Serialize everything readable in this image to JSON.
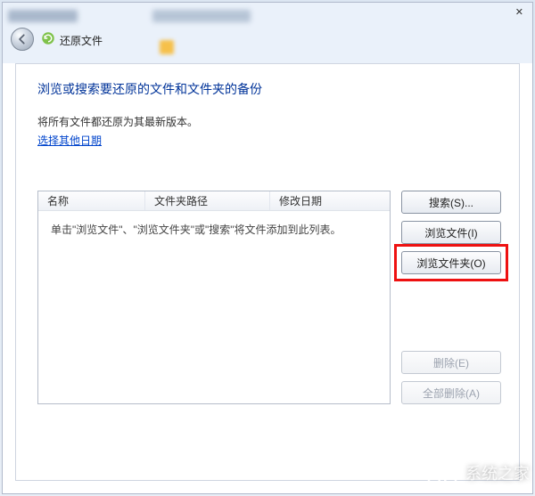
{
  "header": {
    "title": "还原文件",
    "close_glyph": "✕"
  },
  "main": {
    "heading": "浏览或搜索要还原的文件和文件夹的备份",
    "subtext": "将所有文件都还原为其最新版本。",
    "link": "选择其他日期"
  },
  "list": {
    "columns": {
      "name": "名称",
      "path": "文件夹路径",
      "date": "修改日期"
    },
    "placeholder": "单击\"浏览文件\"、\"浏览文件夹\"或\"搜索\"将文件添加到此列表。"
  },
  "buttons": {
    "search": "搜索(S)...",
    "browse_files": "浏览文件(I)",
    "browse_folders": "浏览文件夹(O)",
    "remove": "删除(E)",
    "remove_all": "全部删除(A)"
  },
  "highlight": "browse_folders",
  "watermark_text": "系统之家"
}
